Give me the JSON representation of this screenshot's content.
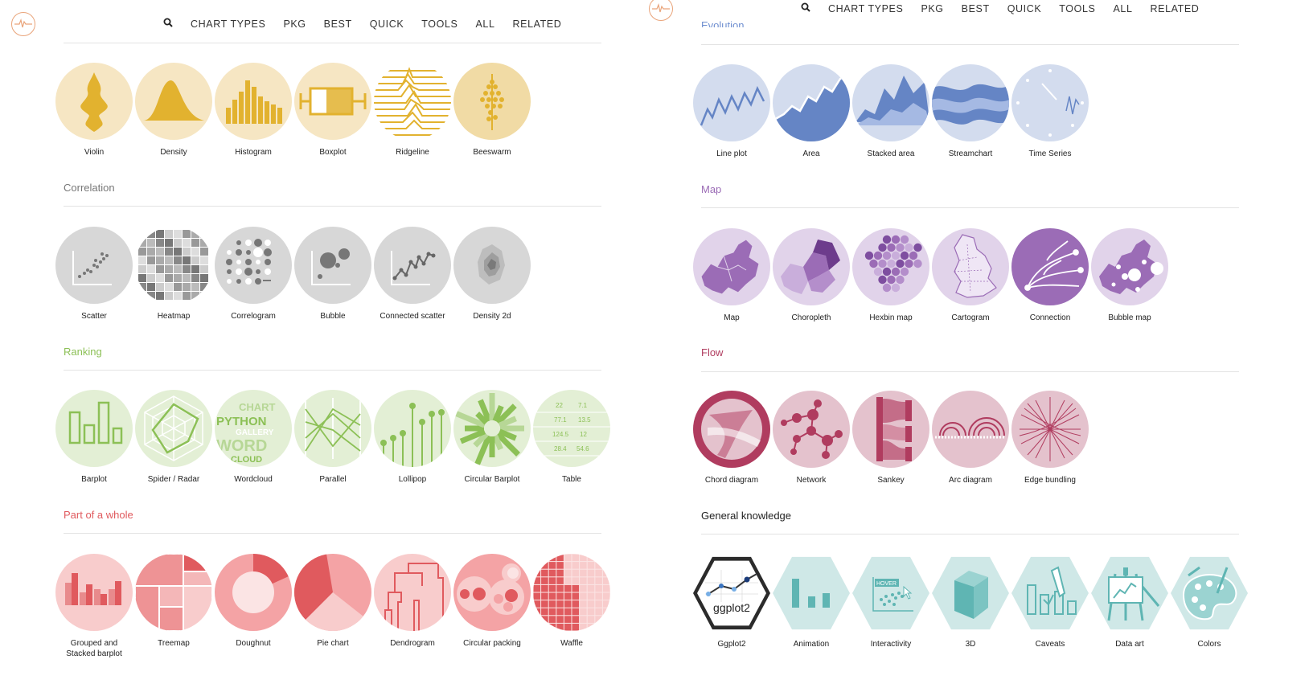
{
  "nav_left": {
    "items": [
      "CHART TYPES",
      "PKG",
      "BEST",
      "QUICK",
      "TOOLS",
      "ALL",
      "RELATED"
    ]
  },
  "nav_right": {
    "items": [
      "CHART TYPES",
      "PKG",
      "BEST",
      "QUICK",
      "TOOLS",
      "ALL",
      "RELATED"
    ]
  },
  "colors": {
    "distribution_bg": "#f6e6c3",
    "distribution_fg": "#e2b22f",
    "correlation_bg": "#d7d7d7",
    "correlation_fg": "#777777",
    "ranking_bg": "#e3efd5",
    "ranking_fg": "#8cc056",
    "part_bg": "#f8cccc",
    "part_fg": "#e05a5e",
    "evolution_bg": "#d3dcee",
    "evolution_fg": "#6585c5",
    "map_bg": "#e1d3ea",
    "map_fg": "#9b6cb6",
    "flow_bg": "#e4c2cd",
    "flow_fg": "#b03c5f",
    "general_bg": "#cfe8e7",
    "general_fg": "#5fb5b3"
  },
  "sections": {
    "evolution": {
      "title": "Evolution"
    },
    "correlation": {
      "title": "Correlation"
    },
    "ranking": {
      "title": "Ranking"
    },
    "part": {
      "title": "Part of a whole"
    },
    "map": {
      "title": "Map"
    },
    "flow": {
      "title": "Flow"
    },
    "general": {
      "title": "General knowledge"
    }
  },
  "charts": {
    "distribution": [
      "Violin",
      "Density",
      "Histogram",
      "Boxplot",
      "Ridgeline",
      "Beeswarm"
    ],
    "correlation": [
      "Scatter",
      "Heatmap",
      "Correlogram",
      "Bubble",
      "Connected scatter",
      "Density 2d"
    ],
    "ranking": [
      "Barplot",
      "Spider / Radar",
      "Wordcloud",
      "Parallel",
      "Lollipop",
      "Circular Barplot",
      "Table"
    ],
    "part": [
      "Grouped and Stacked barplot",
      "Treemap",
      "Doughnut",
      "Pie chart",
      "Dendrogram",
      "Circular packing",
      "Waffle"
    ],
    "evolution": [
      "Line plot",
      "Area",
      "Stacked area",
      "Streamchart",
      "Time Series"
    ],
    "map": [
      "Map",
      "Choropleth",
      "Hexbin map",
      "Cartogram",
      "Connection",
      "Bubble map"
    ],
    "flow": [
      "Chord diagram",
      "Network",
      "Sankey",
      "Arc diagram",
      "Edge bundling"
    ],
    "general": [
      "Ggplot2",
      "Animation",
      "Interactivity",
      "3D",
      "Caveats",
      "Data art",
      "Colors"
    ]
  },
  "thumb_text": {
    "ggplot2": "ggplot2",
    "wordcloud": [
      "PYTHON",
      "GALLERY",
      "WORD",
      "CLOUD",
      "CHART"
    ],
    "table": [
      "22",
      "7.1",
      "77.1",
      "13.5",
      "124.5",
      "12",
      "28.4",
      "54.6"
    ],
    "hover": "HOVER"
  }
}
